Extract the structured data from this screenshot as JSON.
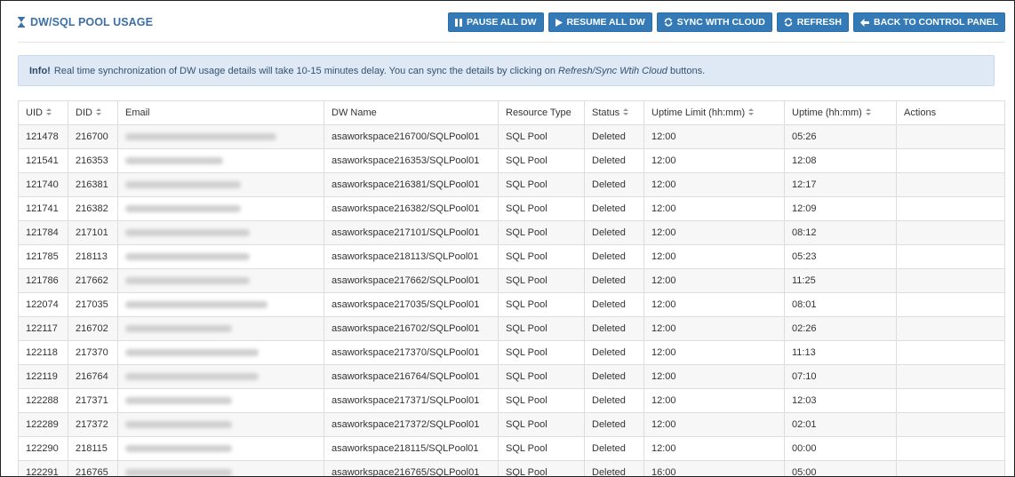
{
  "header": {
    "title": "DW/SQL POOL USAGE",
    "title_icon": "hourglass-icon",
    "accent_color": "#3c6fa6"
  },
  "toolbar": {
    "button_color": "#337ab7",
    "pause": {
      "label": "PAUSE ALL DW",
      "icon": "pause-icon"
    },
    "resume": {
      "label": "RESUME ALL DW",
      "icon": "play-icon"
    },
    "sync": {
      "label": "SYNC WITH CLOUD",
      "icon": "sync-icon"
    },
    "refresh": {
      "label": "REFRESH",
      "icon": "refresh-icon"
    },
    "back": {
      "label": "BACK TO CONTROL PANEL",
      "icon": "arrow-left-icon"
    }
  },
  "info": {
    "strong": "Info!",
    "text_before": "Real time synchronization of DW usage details will take 10-15 minutes delay. You can sync the details by clicking on",
    "emphasis": "Refresh/Sync Wtih Cloud",
    "text_after": "buttons."
  },
  "table": {
    "columns": {
      "uid": "UID",
      "did": "DID",
      "email": "Email",
      "dw_name": "DW Name",
      "resource_type": "Resource Type",
      "status": "Status",
      "uptime_limit": "Uptime Limit (hh:mm)",
      "uptime": "Uptime (hh:mm)",
      "actions": "Actions"
    },
    "rows": [
      {
        "uid": "121478",
        "did": "216700",
        "dw_name": "asaworkspace216700/SQLPool01",
        "resource_type": "SQL Pool",
        "status": "Deleted",
        "uptime_limit": "12:00",
        "uptime": "05:26",
        "actions": ""
      },
      {
        "uid": "121541",
        "did": "216353",
        "dw_name": "asaworkspace216353/SQLPool01",
        "resource_type": "SQL Pool",
        "status": "Deleted",
        "uptime_limit": "12:00",
        "uptime": "12:08",
        "actions": ""
      },
      {
        "uid": "121740",
        "did": "216381",
        "dw_name": "asaworkspace216381/SQLPool01",
        "resource_type": "SQL Pool",
        "status": "Deleted",
        "uptime_limit": "12:00",
        "uptime": "12:17",
        "actions": ""
      },
      {
        "uid": "121741",
        "did": "216382",
        "dw_name": "asaworkspace216382/SQLPool01",
        "resource_type": "SQL Pool",
        "status": "Deleted",
        "uptime_limit": "12:00",
        "uptime": "12:09",
        "actions": ""
      },
      {
        "uid": "121784",
        "did": "217101",
        "dw_name": "asaworkspace217101/SQLPool01",
        "resource_type": "SQL Pool",
        "status": "Deleted",
        "uptime_limit": "12:00",
        "uptime": "08:12",
        "actions": ""
      },
      {
        "uid": "121785",
        "did": "218113",
        "dw_name": "asaworkspace218113/SQLPool01",
        "resource_type": "SQL Pool",
        "status": "Deleted",
        "uptime_limit": "12:00",
        "uptime": "05:23",
        "actions": ""
      },
      {
        "uid": "121786",
        "did": "217662",
        "dw_name": "asaworkspace217662/SQLPool01",
        "resource_type": "SQL Pool",
        "status": "Deleted",
        "uptime_limit": "12:00",
        "uptime": "11:25",
        "actions": ""
      },
      {
        "uid": "122074",
        "did": "217035",
        "dw_name": "asaworkspace217035/SQLPool01",
        "resource_type": "SQL Pool",
        "status": "Deleted",
        "uptime_limit": "12:00",
        "uptime": "08:01",
        "actions": ""
      },
      {
        "uid": "122117",
        "did": "216702",
        "dw_name": "asaworkspace216702/SQLPool01",
        "resource_type": "SQL Pool",
        "status": "Deleted",
        "uptime_limit": "12:00",
        "uptime": "02:26",
        "actions": ""
      },
      {
        "uid": "122118",
        "did": "217370",
        "dw_name": "asaworkspace217370/SQLPool01",
        "resource_type": "SQL Pool",
        "status": "Deleted",
        "uptime_limit": "12:00",
        "uptime": "11:13",
        "actions": ""
      },
      {
        "uid": "122119",
        "did": "216764",
        "dw_name": "asaworkspace216764/SQLPool01",
        "resource_type": "SQL Pool",
        "status": "Deleted",
        "uptime_limit": "12:00",
        "uptime": "07:10",
        "actions": ""
      },
      {
        "uid": "122288",
        "did": "217371",
        "dw_name": "asaworkspace217371/SQLPool01",
        "resource_type": "SQL Pool",
        "status": "Deleted",
        "uptime_limit": "12:00",
        "uptime": "12:03",
        "actions": ""
      },
      {
        "uid": "122289",
        "did": "217372",
        "dw_name": "asaworkspace217372/SQLPool01",
        "resource_type": "SQL Pool",
        "status": "Deleted",
        "uptime_limit": "12:00",
        "uptime": "02:01",
        "actions": ""
      },
      {
        "uid": "122290",
        "did": "218115",
        "dw_name": "asaworkspace218115/SQLPool01",
        "resource_type": "SQL Pool",
        "status": "Deleted",
        "uptime_limit": "12:00",
        "uptime": "00:00",
        "actions": ""
      },
      {
        "uid": "122291",
        "did": "216765",
        "dw_name": "asaworkspace216765/SQLPool01",
        "resource_type": "SQL Pool",
        "status": "Deleted",
        "uptime_limit": "16:00",
        "uptime": "05:00",
        "actions": ""
      }
    ]
  }
}
